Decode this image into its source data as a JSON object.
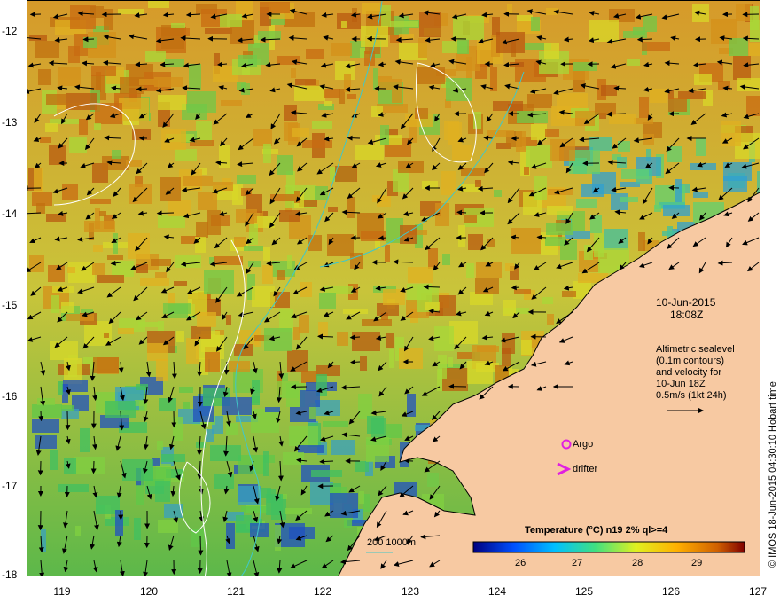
{
  "map": {
    "lon_ticks": [
      "119",
      "120",
      "121",
      "122",
      "123",
      "124",
      "125",
      "126",
      "127"
    ],
    "lat_ticks": [
      "-12",
      "-13",
      "-14",
      "-15",
      "-16",
      "-17",
      "-18"
    ],
    "date_line1": "10-Jun-2015",
    "date_line2": "18:08Z",
    "info_lines": [
      "Altimetric sealevel",
      "(0.1m contours)",
      "and velocity for",
      "10-Jun 18Z",
      "0.5m/s (1kt 24h)"
    ],
    "argo_label": "Argo",
    "drifter_label": "drifter",
    "depth_label": "200  1000m",
    "colorbar_title": "Temperature (°C) n19 2% ql>=4",
    "colorbar_ticks": [
      "26",
      "27",
      "28",
      "29"
    ],
    "credit": "© IMOS 18-Jun-2015 04:30:10 Hobart time",
    "colors": {
      "land": "#f7c9a2",
      "argo": "#e020e0",
      "drifter": "#e020e0",
      "contour_isobath": "#40c8c8"
    }
  }
}
